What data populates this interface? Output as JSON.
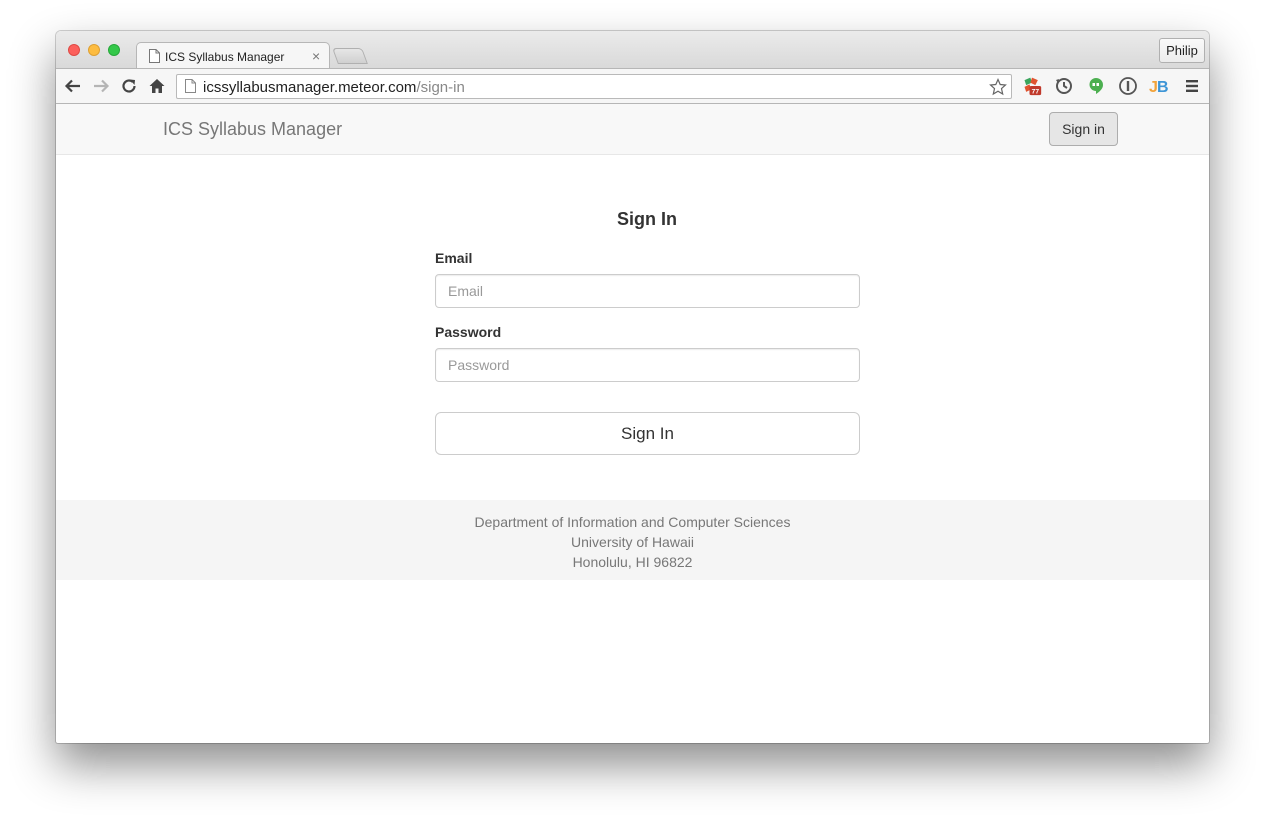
{
  "browser": {
    "tab_title": "ICS Syllabus Manager",
    "tab_close": "×",
    "profile_name": "Philip",
    "url_host": "icssyllabusmanager.meteor.com",
    "url_path": "/sign-in",
    "extension_badge": "77",
    "icons": {
      "back": "back-arrow-icon",
      "forward": "forward-arrow-icon",
      "reload": "reload-icon",
      "home": "home-icon",
      "bookmark": "star-icon",
      "menu": "hamburger-menu-icon"
    }
  },
  "navbar": {
    "brand": "ICS Syllabus Manager",
    "signin_label": "Sign in"
  },
  "form": {
    "title": "Sign In",
    "email_label": "Email",
    "email_placeholder": "Email",
    "email_value": "",
    "password_label": "Password",
    "password_placeholder": "Password",
    "password_value": "",
    "submit_label": "Sign In"
  },
  "footer": {
    "line1": "Department of Information and Computer Sciences",
    "line2": "University of Hawaii",
    "line3": "Honolulu, HI 96822"
  },
  "colors": {
    "traffic_red": "#fc605c",
    "traffic_yellow": "#fdbc40",
    "traffic_green": "#34c84a",
    "navbar_bg": "#f8f8f8",
    "footer_bg": "#f5f5f5"
  }
}
